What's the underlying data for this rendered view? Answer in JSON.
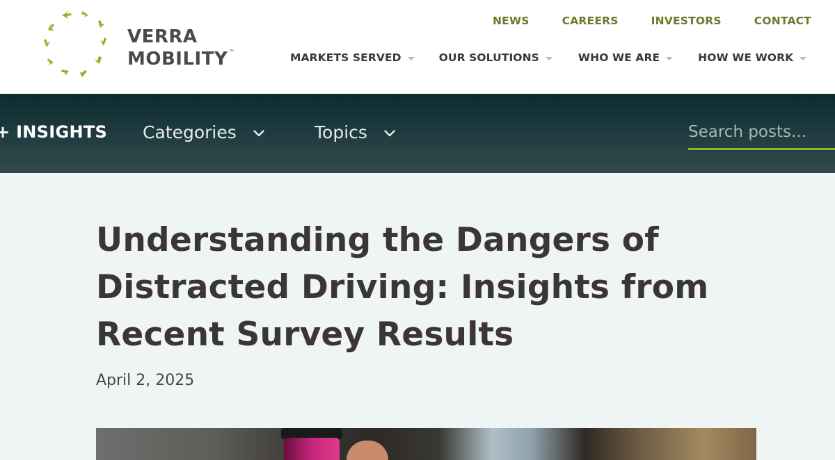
{
  "brand": {
    "line1": "VERRA",
    "line2": "MOBILITY",
    "trademark": "™",
    "accent_color": "#8eb52b",
    "text_color": "#4a4a4a"
  },
  "utility_nav": [
    {
      "label": "NEWS"
    },
    {
      "label": "CAREERS"
    },
    {
      "label": "INVESTORS"
    },
    {
      "label": "CONTACT"
    }
  ],
  "main_nav": [
    {
      "label": "MARKETS SERVED",
      "icon": "caret-down-icon"
    },
    {
      "label": "OUR SOLUTIONS",
      "icon": "caret-down-icon"
    },
    {
      "label": "WHO WE ARE",
      "icon": "caret-down-icon"
    },
    {
      "label": "HOW WE WORK",
      "icon": "caret-down-icon"
    }
  ],
  "insights_bar": {
    "title": "+ INSIGHTS",
    "filters": [
      {
        "label": "Categories",
        "icon": "chevron-down-icon"
      },
      {
        "label": "Topics",
        "icon": "chevron-down-icon"
      }
    ],
    "search": {
      "placeholder": "Search posts...",
      "value": ""
    },
    "background_color": "#1d3a3f"
  },
  "article": {
    "title": "Understanding the Dangers of Distracted Driving: Insights from Recent Survey Results",
    "date": "April 2, 2025"
  }
}
